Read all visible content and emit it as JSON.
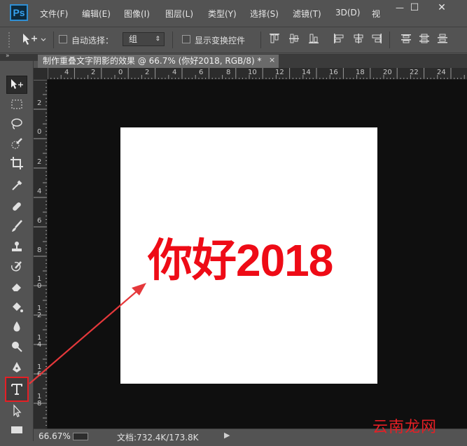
{
  "app": {
    "logo": "Ps"
  },
  "menu": {
    "items": [
      "文件(F)",
      "编辑(E)",
      "图像(I)",
      "图层(L)",
      "类型(Y)",
      "选择(S)",
      "滤镜(T)",
      "3D(D)",
      "视"
    ]
  },
  "window_controls": {
    "minimize": "—",
    "maximize": "☐",
    "close": "✕"
  },
  "options": {
    "auto_select_label": "自动选择：",
    "group_value": "组",
    "show_transform_label": "显示变换控件"
  },
  "document": {
    "tab_title": "制作重叠文字阴影的效果 @ 66.7% (你好2018, RGB/8) *",
    "close": "×",
    "text": "你好2018"
  },
  "rulers": {
    "horizontal": [
      "4",
      "2",
      "0",
      "2",
      "4",
      "6",
      "8",
      "10",
      "12",
      "14",
      "16",
      "18",
      "20",
      "22",
      "24"
    ],
    "vertical": [
      "2",
      "0",
      "2",
      "4",
      "6",
      "8",
      "1\n0",
      "1\n2",
      "1\n4",
      "1\n6",
      "1\n8"
    ]
  },
  "status": {
    "zoom": "66.67%",
    "doc_size": "文档:732.4K/173.8K",
    "arrow": "▶"
  },
  "watermark": "云南龙网",
  "colors": {
    "accent_red": "#e51f25",
    "text_red": "#ee0b16"
  }
}
